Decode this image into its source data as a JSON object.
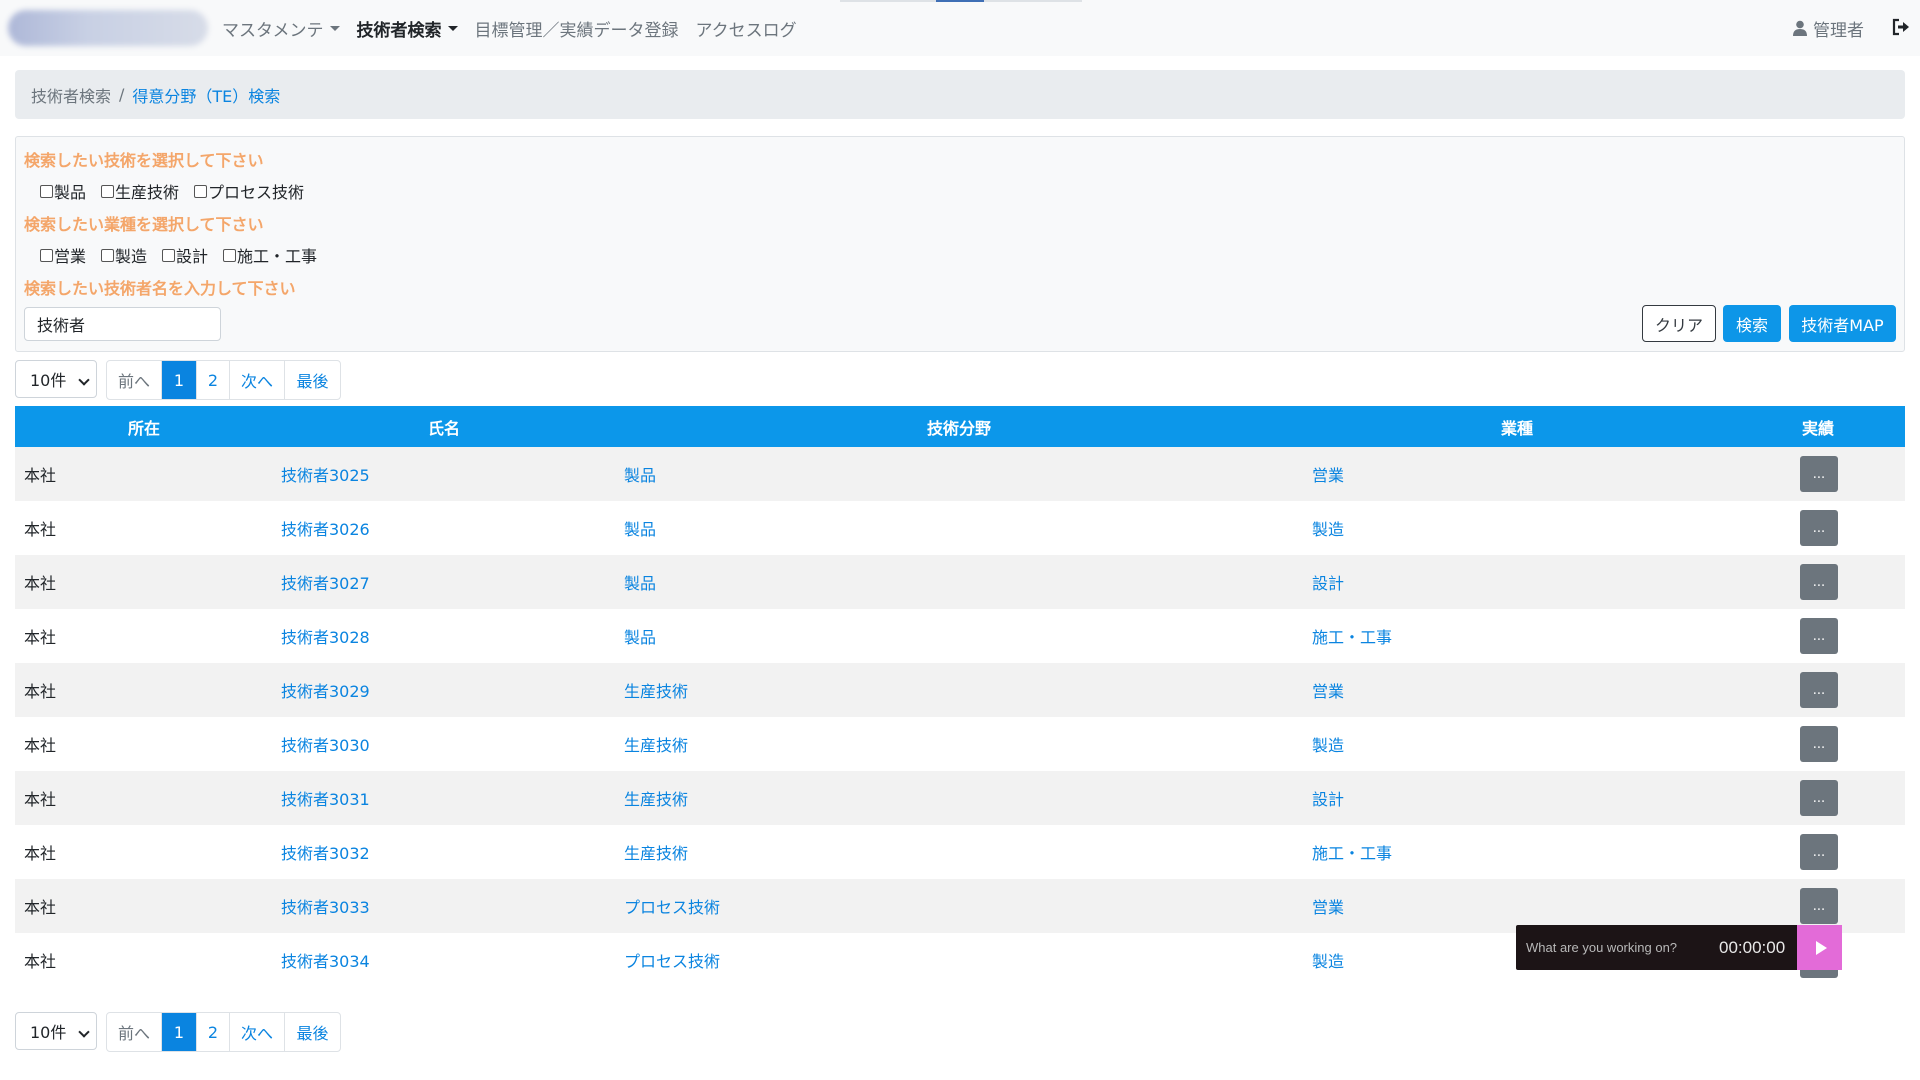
{
  "nav": {
    "items": [
      {
        "label": "マスタメンテ",
        "dropdown": true,
        "active": false
      },
      {
        "label": "技術者検索",
        "dropdown": true,
        "active": true
      },
      {
        "label": "目標管理／実績データ登録",
        "dropdown": false,
        "active": false
      },
      {
        "label": "アクセスログ",
        "dropdown": false,
        "active": false
      }
    ],
    "user_label": "管理者",
    "user_icon": "user-icon",
    "logout_icon": "sign-out-icon"
  },
  "breadcrumb": {
    "first": "技術者検索",
    "separator": "/",
    "current": "得意分野（TE）検索"
  },
  "search": {
    "tech_label": "検索したい技術を選択して下さい",
    "tech_options": [
      "製品",
      "生産技術",
      "プロセス技術"
    ],
    "industry_label": "検索したい業種を選択して下さい",
    "industry_options": [
      "営業",
      "製造",
      "設計",
      "施工・工事"
    ],
    "name_label": "検索したい技術者名を入力して下さい",
    "name_value": "技術者",
    "clear_button": "クリア",
    "search_button": "検索",
    "map_button": "技術者MAP"
  },
  "pagination": {
    "per_page": "10件",
    "prev": "前へ",
    "pages": [
      "1",
      "2"
    ],
    "current_page": "1",
    "next": "次へ",
    "last": "最後"
  },
  "table": {
    "headers": {
      "location": "所在",
      "name": "氏名",
      "tech": "技術分野",
      "industry": "業種",
      "results": "実績"
    },
    "rows": [
      {
        "location": "本社",
        "name": "技術者3025",
        "tech": "製品",
        "industry": "営業",
        "action": "..."
      },
      {
        "location": "本社",
        "name": "技術者3026",
        "tech": "製品",
        "industry": "製造",
        "action": "..."
      },
      {
        "location": "本社",
        "name": "技術者3027",
        "tech": "製品",
        "industry": "設計",
        "action": "..."
      },
      {
        "location": "本社",
        "name": "技術者3028",
        "tech": "製品",
        "industry": "施工・工事",
        "action": "..."
      },
      {
        "location": "本社",
        "name": "技術者3029",
        "tech": "生産技術",
        "industry": "営業",
        "action": "..."
      },
      {
        "location": "本社",
        "name": "技術者3030",
        "tech": "生産技術",
        "industry": "製造",
        "action": "..."
      },
      {
        "location": "本社",
        "name": "技術者3031",
        "tech": "生産技術",
        "industry": "設計",
        "action": "..."
      },
      {
        "location": "本社",
        "name": "技術者3032",
        "tech": "生産技術",
        "industry": "施工・工事",
        "action": "..."
      },
      {
        "location": "本社",
        "name": "技術者3033",
        "tech": "プロセス技術",
        "industry": "営業",
        "action": "..."
      },
      {
        "location": "本社",
        "name": "技術者3034",
        "tech": "プロセス技術",
        "industry": "製造",
        "action": "..."
      }
    ]
  },
  "timer": {
    "placeholder": "What are you working on?",
    "time": "00:00:00",
    "play_icon": "play-icon"
  },
  "colors": {
    "header_blue": "#0c97ea",
    "link_blue": "#0a84e0",
    "label_orange": "#f4a66a",
    "timer_pink": "#e36bd8"
  }
}
